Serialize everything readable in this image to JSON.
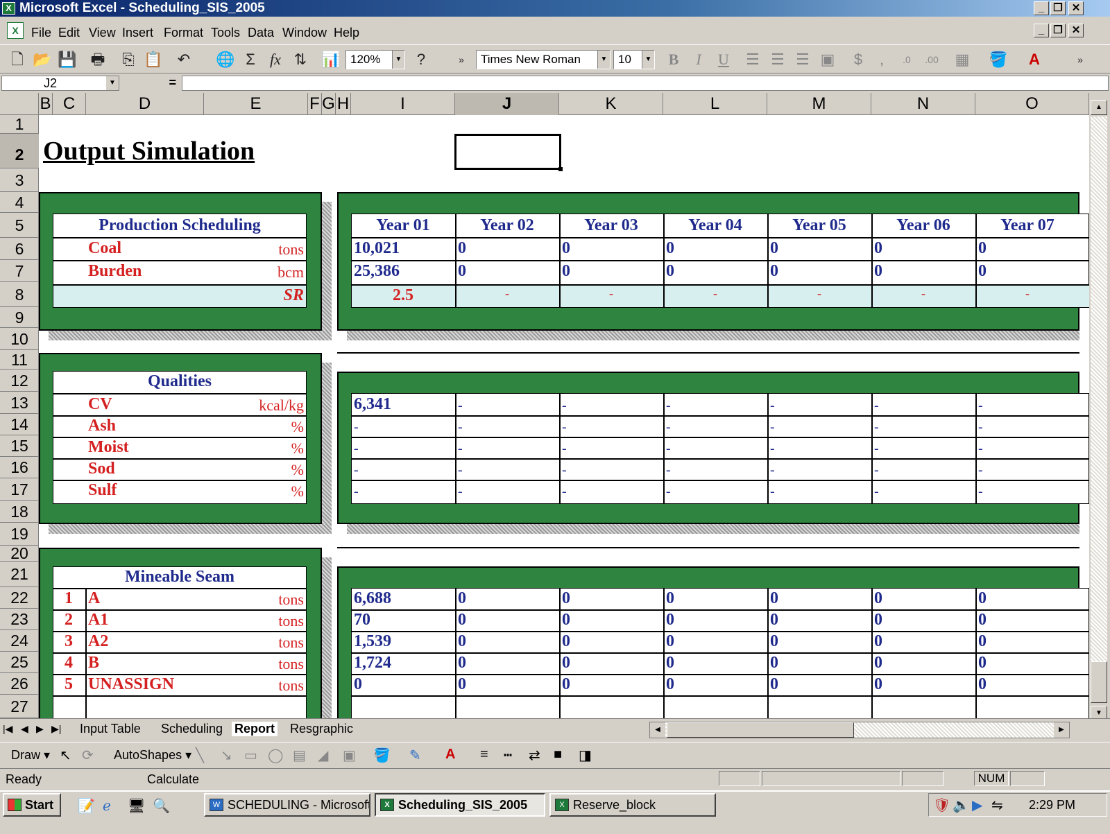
{
  "window": {
    "title": "Microsoft Excel - Scheduling_SIS_2005"
  },
  "menu": [
    "File",
    "Edit",
    "View",
    "Insert",
    "Format",
    "Tools",
    "Data",
    "Window",
    "Help"
  ],
  "toolbar": {
    "zoom": "120%",
    "font": "Times New Roman",
    "size": "10"
  },
  "formula": {
    "cell": "J2",
    "eq": "="
  },
  "columns": [
    "B",
    "C",
    "D",
    "E",
    "F",
    "G",
    "H",
    "I",
    "J",
    "K",
    "L",
    "M",
    "N",
    "O"
  ],
  "rows": [
    "1",
    "2",
    "3",
    "4",
    "5",
    "6",
    "7",
    "8",
    "9",
    "10",
    "11",
    "12",
    "13",
    "14",
    "15",
    "16",
    "17",
    "18",
    "19",
    "20",
    "21",
    "22",
    "23",
    "24",
    "25",
    "26",
    "27"
  ],
  "sheet": {
    "title": "Output Simulation",
    "production": {
      "header": "Production Scheduling",
      "coal": {
        "label": "Coal",
        "unit": "tons"
      },
      "burden": {
        "label": "Burden",
        "unit": "bcm"
      },
      "sr": "SR",
      "years": [
        "Year 01",
        "Year 02",
        "Year 03",
        "Year 04",
        "Year 05",
        "Year 06",
        "Year 07"
      ],
      "coal_values": [
        "10,021",
        "0",
        "0",
        "0",
        "0",
        "0",
        "0"
      ],
      "burden_values": [
        "25,386",
        "0",
        "0",
        "0",
        "0",
        "0",
        "0"
      ],
      "sr_values": [
        "2.5",
        "-",
        "-",
        "-",
        "-",
        "-",
        "-"
      ]
    },
    "qualities": {
      "header": "Qualities",
      "items": [
        {
          "label": "CV",
          "unit": "kcal/kg",
          "values": [
            "6,341",
            "-",
            "-",
            "-",
            "-",
            "-",
            "-"
          ]
        },
        {
          "label": "Ash",
          "unit": "%",
          "values": [
            "-",
            "-",
            "-",
            "-",
            "-",
            "-",
            "-"
          ]
        },
        {
          "label": "Moist",
          "unit": "%",
          "values": [
            "-",
            "-",
            "-",
            "-",
            "-",
            "-",
            "-"
          ]
        },
        {
          "label": "Sod",
          "unit": "%",
          "values": [
            "-",
            "-",
            "-",
            "-",
            "-",
            "-",
            "-"
          ]
        },
        {
          "label": "Sulf",
          "unit": "%",
          "values": [
            "-",
            "-",
            "-",
            "-",
            "-",
            "-",
            "-"
          ]
        }
      ]
    },
    "seam": {
      "header": "Mineable Seam",
      "items": [
        {
          "no": "1",
          "label": "A",
          "unit": "tons",
          "values": [
            "6,688",
            "0",
            "0",
            "0",
            "0",
            "0",
            "0"
          ]
        },
        {
          "no": "2",
          "label": "A1",
          "unit": "tons",
          "values": [
            "70",
            "0",
            "0",
            "0",
            "0",
            "0",
            "0"
          ]
        },
        {
          "no": "3",
          "label": "A2",
          "unit": "tons",
          "values": [
            "1,539",
            "0",
            "0",
            "0",
            "0",
            "0",
            "0"
          ]
        },
        {
          "no": "4",
          "label": "B",
          "unit": "tons",
          "values": [
            "1,724",
            "0",
            "0",
            "0",
            "0",
            "0",
            "0"
          ]
        },
        {
          "no": "5",
          "label": "UNASSIGN",
          "unit": "tons",
          "values": [
            "0",
            "0",
            "0",
            "0",
            "0",
            "0",
            "0"
          ]
        }
      ]
    }
  },
  "tabs": [
    "Input Table",
    "Scheduling",
    "Report",
    "Resgraphic"
  ],
  "draw": {
    "draw": "Draw",
    "autoshapes": "AutoShapes"
  },
  "status": {
    "left": "Ready",
    "calc": "Calculate",
    "num": "NUM"
  },
  "taskbar": {
    "start": "Start",
    "tasks": [
      "SCHEDULING - Microsoft ...",
      "Scheduling_SIS_2005",
      "Reserve_block"
    ],
    "clock": "2:29 PM"
  }
}
